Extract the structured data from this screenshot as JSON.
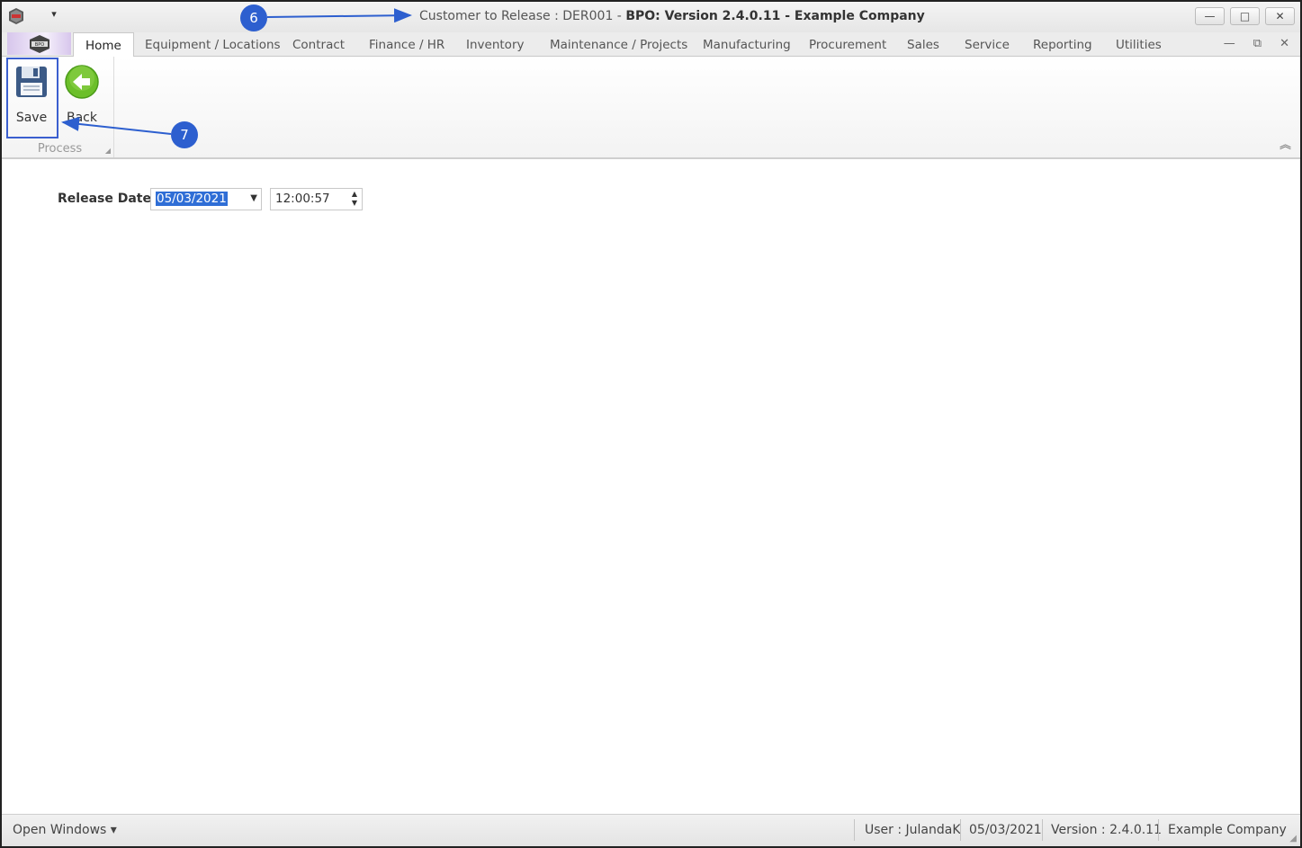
{
  "window": {
    "title_prefix": "Customer to Release : DER001 - ",
    "title_bold": "BPO: Version 2.4.0.11 - Example Company",
    "app_icon": "bpo-logo-icon",
    "quick_access_symbol": "▾",
    "buttons": {
      "minimize": "—",
      "maximize": "□",
      "close": "✕"
    }
  },
  "tabs": {
    "items": [
      {
        "label": "Home",
        "active": true
      },
      {
        "label": "Equipment / Locations"
      },
      {
        "label": "Contract"
      },
      {
        "label": "Finance / HR"
      },
      {
        "label": "Inventory"
      },
      {
        "label": "Maintenance / Projects"
      },
      {
        "label": "Manufacturing"
      },
      {
        "label": "Procurement"
      },
      {
        "label": "Sales"
      },
      {
        "label": "Service"
      },
      {
        "label": "Reporting"
      },
      {
        "label": "Utilities"
      }
    ],
    "mdi": {
      "minimize": "—",
      "restore": "⧉",
      "close": "✕"
    }
  },
  "ribbon": {
    "group_label": "Process",
    "save_label": "Save",
    "back_label": "Back",
    "save_icon": "floppy-disk-icon",
    "back_icon": "back-arrow-icon",
    "collapse_symbol": "︽"
  },
  "form": {
    "release_date_label": "Release Date",
    "release_date_value": "05/03/2021",
    "release_time_value": "12:00:57"
  },
  "statusbar": {
    "open_windows": "Open Windows ▾",
    "user": "User : JulandaK",
    "date": "05/03/2021",
    "version": "Version : 2.4.0.11",
    "company": "Example Company"
  },
  "annotations": {
    "step6": "6",
    "step7": "7",
    "color": "#2d5fcf"
  }
}
